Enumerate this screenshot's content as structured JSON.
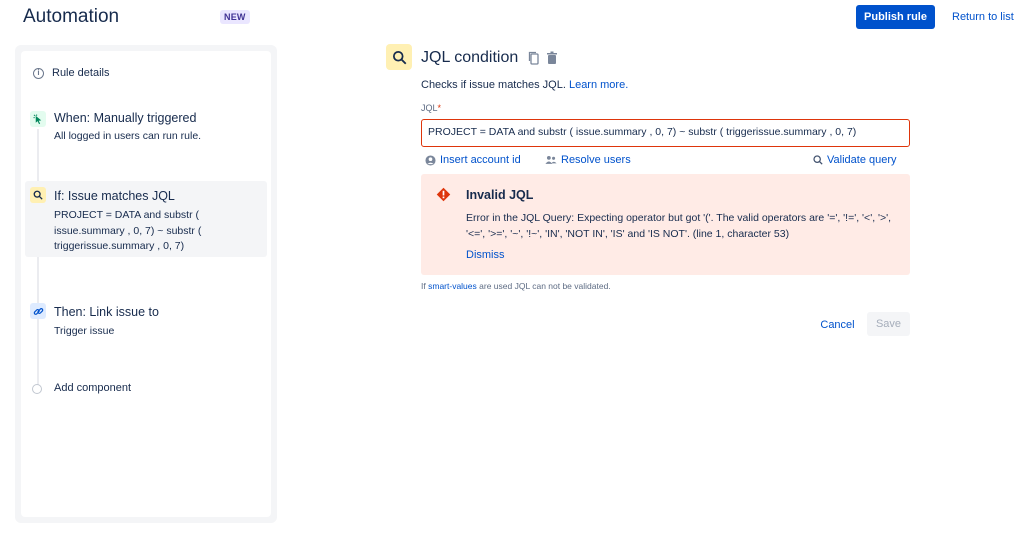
{
  "header": {
    "title": "Automation",
    "badge": "NEW",
    "publish_label": "Publish rule",
    "return_label": "Return to list"
  },
  "sidebar": {
    "rule_details_label": "Rule details",
    "steps": [
      {
        "title": "When: Manually triggered",
        "desc": "All logged in users can run rule.",
        "icon": "cursor-click-icon",
        "color": "#e3fcef"
      },
      {
        "title": "If: Issue matches JQL",
        "desc": "PROJECT = DATA and substr ( issue.summary , 0, 7) ~ substr ( triggerissue.summary , 0, 7)",
        "icon": "search-icon",
        "color": "#fff0b3"
      },
      {
        "title": "Then: Link issue to",
        "desc": "Trigger issue",
        "icon": "link-icon",
        "color": "#deebff"
      }
    ],
    "add_component_label": "Add component"
  },
  "condition": {
    "title": "JQL condition",
    "desc_prefix": "Checks if issue matches JQL.",
    "learn_more": "Learn more.",
    "jql_label": "JQL",
    "jql_required_mark": "*",
    "jql_value": "PROJECT = DATA and substr ( issue.summary , 0, 7) ~ substr ( triggerissue.summary , 0, 7)",
    "insert_account_label": "Insert account id",
    "resolve_users_label": "Resolve users",
    "validate_query_label": "Validate query"
  },
  "error": {
    "title": "Invalid JQL",
    "message": "Error in the JQL Query: Expecting operator but got '('. The valid operators are '=', '!=', '<', '>', '<=', '>=', '~', '!~', 'IN', 'NOT IN', 'IS' and 'IS NOT'. (line 1, character 53)",
    "dismiss_label": "Dismiss"
  },
  "hint": {
    "prefix": "If",
    "link": "smart-values",
    "suffix": "are used JQL can not be validated."
  },
  "actions": {
    "cancel_label": "Cancel",
    "save_label": "Save"
  },
  "colors": {
    "primary": "#0052cc",
    "error_bg": "#ffebe6",
    "error_border": "#de350b"
  }
}
